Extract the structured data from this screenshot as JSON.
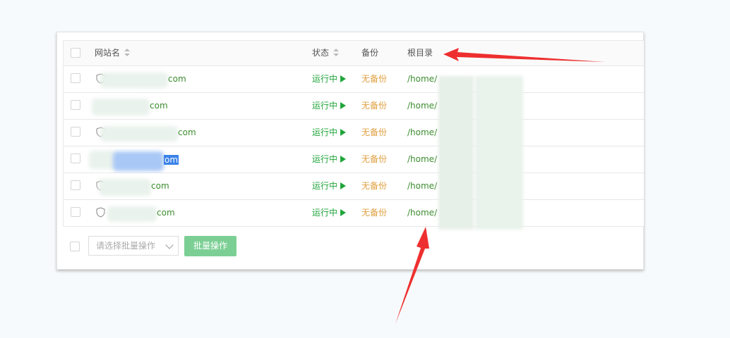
{
  "table": {
    "headers": {
      "site_name": "网站名",
      "status": "状态",
      "backup": "备份",
      "root_dir": "根目录"
    },
    "rows": [
      {
        "site_suffix": "com",
        "status": "运行中",
        "backup": "无备份",
        "root_prefix": "/home/"
      },
      {
        "site_suffix": "com",
        "status": "运行中",
        "backup": "无备份",
        "root_prefix": "/home/"
      },
      {
        "site_suffix": "com",
        "status": "运行中",
        "backup": "无备份",
        "root_prefix": "/home/"
      },
      {
        "site_suffix": "om",
        "status": "运行中",
        "backup": "无备份",
        "root_prefix": "/home/"
      },
      {
        "site_suffix": "com",
        "status": "运行中",
        "backup": "无备份",
        "root_prefix": "/home/"
      },
      {
        "site_suffix": "com",
        "status": "运行中",
        "backup": "无备份",
        "root_prefix": "/home/"
      }
    ]
  },
  "footer": {
    "batch_select_placeholder": "请选择批量操作",
    "batch_button": "批量操作"
  },
  "colors": {
    "running": "#20a53a",
    "no_backup": "#e0a040",
    "arrow": "#ee2f2f",
    "batch_button": "#7ccf94"
  },
  "icons": [
    "checkbox-icon",
    "sort-icon",
    "shield-icon",
    "play-icon",
    "chevron-down-icon",
    "red-arrow"
  ]
}
